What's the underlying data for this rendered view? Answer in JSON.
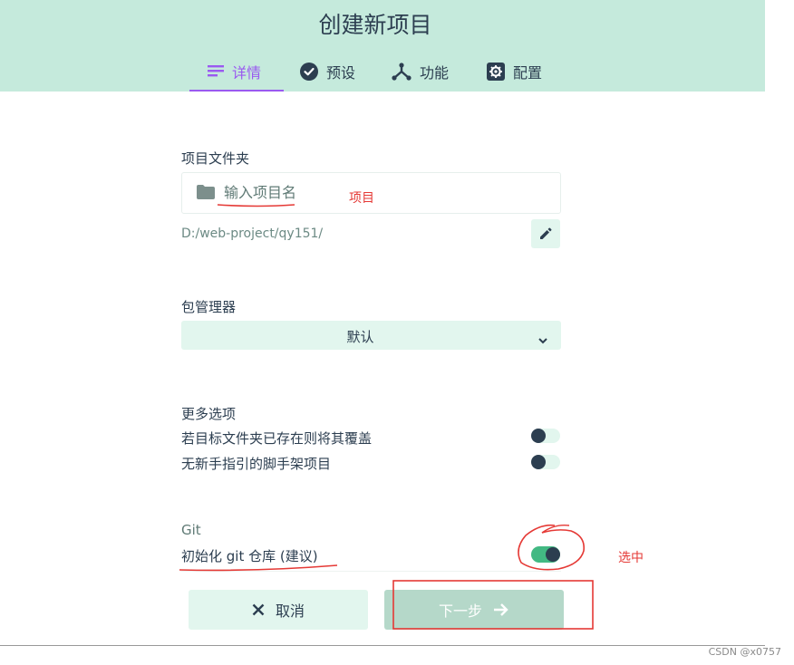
{
  "header": {
    "title": "创建新项目",
    "tabs": [
      {
        "label": "详情",
        "icon": "list-icon",
        "active": true
      },
      {
        "label": "预设",
        "icon": "check-circle-icon",
        "active": false
      },
      {
        "label": "功能",
        "icon": "tree-icon",
        "active": false
      },
      {
        "label": "配置",
        "icon": "gear-icon",
        "active": false
      }
    ]
  },
  "project_folder": {
    "label": "项目文件夹",
    "placeholder": "输入项目名",
    "value": "",
    "path": "D:/web-project/qy151/",
    "icons": {
      "folder": "folder-icon",
      "edit": "pencil-icon"
    }
  },
  "package_manager": {
    "label": "包管理器",
    "selected": "默认"
  },
  "more_options": {
    "label": "更多选项",
    "items": [
      {
        "label": "若目标文件夹已存在则将其覆盖",
        "enabled": false
      },
      {
        "label": "无新手指引的脚手架项目",
        "enabled": false
      }
    ]
  },
  "git": {
    "label": "Git",
    "init_label": "初始化 git 仓库 (建议)",
    "enabled": true
  },
  "buttons": {
    "cancel": "取消",
    "next": "下一步"
  },
  "annotations": {
    "project_note": "项目",
    "selected_note": "选中"
  },
  "watermark": "CSDN @x0757",
  "colors": {
    "header_bg": "#c5eadc",
    "accent": "#9a5af0",
    "toggle_on": "#42b983",
    "annotation": "#e53935"
  }
}
